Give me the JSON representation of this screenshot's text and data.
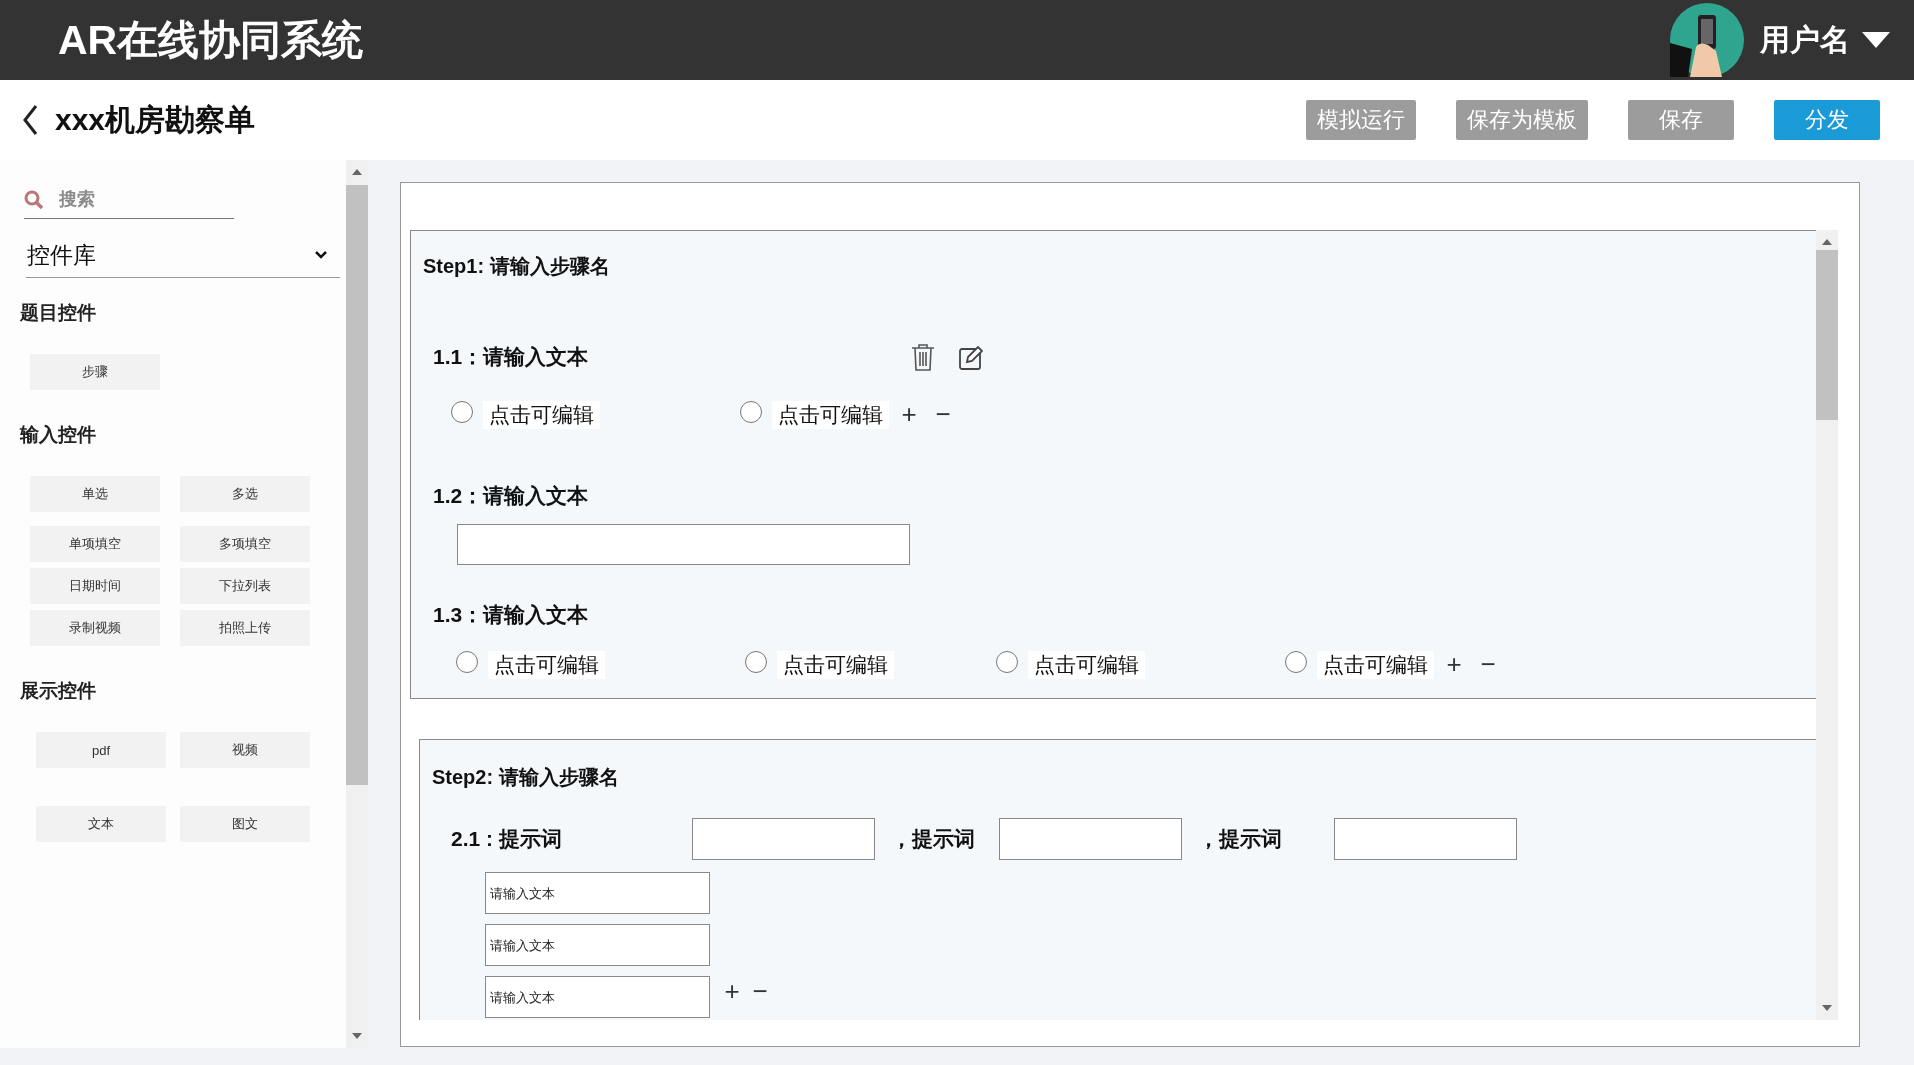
{
  "header": {
    "title": "AR在线协同系统",
    "user": "用户名"
  },
  "toolbar": {
    "title": "xxx机房勘察单",
    "buttons": [
      {
        "label": "模拟运行",
        "kind": "disabled"
      },
      {
        "label": "保存为模板",
        "kind": "disabled"
      },
      {
        "label": "保存",
        "kind": "disabled"
      },
      {
        "label": "分发",
        "kind": "primary"
      }
    ]
  },
  "sidebar": {
    "search": {
      "placeholder": "搜索"
    },
    "library": "控件库",
    "groups": [
      {
        "title": "题目控件",
        "items": [
          "步骤"
        ]
      },
      {
        "title": "输入控件",
        "items": [
          "单选",
          "多选",
          "单项填空",
          "多项填空",
          "日期时间",
          "下拉列表",
          "录制视频",
          "拍照上传"
        ]
      },
      {
        "title": "展示控件",
        "items": [
          "pdf",
          "视频",
          "文本",
          "图文"
        ]
      }
    ]
  },
  "steps": [
    {
      "title": "Step1:  请输入步骤名",
      "questions": [
        {
          "kind": "radio",
          "label": "1.1：请输入文本",
          "tools": true,
          "options": [
            {
              "label": "点击可编辑",
              "selected": false
            },
            {
              "label": "点击可编辑",
              "selected": false
            }
          ],
          "controls": [
            "+",
            "−"
          ]
        },
        {
          "kind": "input",
          "label": "1.2：请输入文本"
        },
        {
          "kind": "radio",
          "label": "1.3：请输入文本",
          "tools": false,
          "options": [
            {
              "label": "点击可编辑",
              "selected": false
            },
            {
              "label": "点击可编辑",
              "selected": false
            },
            {
              "label": "点击可编辑",
              "selected": false
            },
            {
              "label": "点击可编辑",
              "selected": false
            }
          ],
          "controls": [
            "+",
            "−"
          ]
        }
      ]
    },
    {
      "title": "Step2:  请输入步骤名",
      "questions": [
        {
          "kind": "fill",
          "label": "2.1 : 提示词",
          "separators": [
            "，提示词",
            "，提示词"
          ],
          "entries": [
            {
              "placeholder": "请输入文本"
            },
            {
              "placeholder": "请输入文本"
            },
            {
              "placeholder": "请输入文本"
            }
          ],
          "controls": [
            "+",
            "−"
          ]
        }
      ]
    }
  ]
}
